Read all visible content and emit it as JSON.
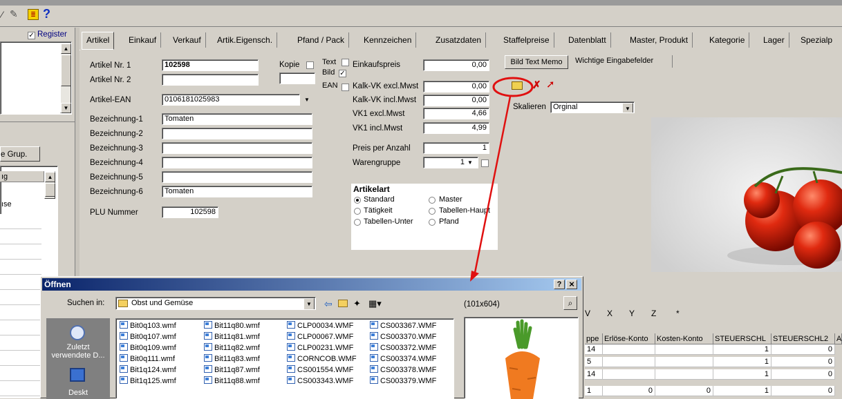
{
  "toolbar": {
    "help_label": "?"
  },
  "left_panel": {
    "register_label": "Register",
    "register_checked": true,
    "group_tab_label": "e Grup.",
    "col_header": "ıg",
    "list_item": "ıse",
    "list_item2": "e"
  },
  "tabs": [
    "Artikel",
    "Einkauf",
    "Verkauf",
    "Artik.Eigensch.",
    "Pfand / Pack",
    "Kennzeichen",
    "Zusatzdaten",
    "Staffelpreise",
    "Datenblatt",
    "Master, Produkt",
    "Kategorie",
    "Lager",
    "Spezialp"
  ],
  "form": {
    "artikel_nr1_label": "Artikel Nr. 1",
    "artikel_nr1_value": "102598",
    "artikel_nr2_label": "Artikel Nr. 2",
    "artikel_nr2_value": "",
    "kopie_label": "Kopie",
    "artikel_ean_label": "Artikel-EAN",
    "artikel_ean_value": "0106181025983",
    "bez1_label": "Bezeichnung-1",
    "bez1_value": "Tomaten",
    "bez2_label": "Bezeichnung-2",
    "bez3_label": "Bezeichnung-3",
    "bez4_label": "Bezeichnung-4",
    "bez5_label": "Bezeichnung-5",
    "bez6_label": "Bezeichnung-6",
    "bez6_value": "Tomaten",
    "plu_label": "PLU Nummer",
    "plu_value": "102598",
    "text_label": "Text",
    "bild_label": "Bild",
    "ean_label": "EAN",
    "einkaufspreis_label": "Einkaufspreis",
    "einkaufspreis_value": "0,00",
    "kalk_vk_excl_label": "Kalk-VK excl.Mwst",
    "kalk_vk_excl_value": "0,00",
    "kalk_vk_incl_label": "Kalk-VK incl.Mwst",
    "kalk_vk_incl_value": "0,00",
    "vk1_excl_label": "VK1 excl.Mwst",
    "vk1_excl_value": "4,66",
    "vk1_incl_label": "VK1 incl.Mwst",
    "vk1_incl_value": "4,99",
    "preis_per_anzahl_label": "Preis per Anzahl",
    "preis_per_anzahl_value": "1",
    "warengruppe_label": "Warengruppe",
    "warengruppe_value": "1",
    "artikelart_label": "Artikelart",
    "artikelart_options": [
      "Standard",
      "Master",
      "Tätigkeit",
      "Tabellen-Haupt",
      "Tabellen-Unter",
      "Pfand"
    ]
  },
  "right_panel": {
    "subtab_active": "Bild Text Memo",
    "subtab_other": "Wichtige Eingabefelder",
    "skalieren_label": "Skalieren",
    "skalieren_value": "Orginal"
  },
  "alphabet": [
    "V",
    "X",
    "Y",
    "Z",
    "*"
  ],
  "grid": {
    "headers": [
      "ppe",
      "Erlöse-Konto",
      "Kosten-Konto",
      "STEUERSCHL",
      "STEUERSCHL2",
      "A"
    ],
    "rows": [
      [
        "14",
        "",
        "",
        "1",
        "0"
      ],
      [
        "5",
        "",
        "",
        "1",
        "0"
      ],
      [
        "14",
        "",
        "",
        "1",
        "0"
      ],
      [
        "1",
        "0",
        "0",
        "1",
        "0"
      ]
    ]
  },
  "dialog": {
    "title": "Öffnen",
    "help_btn": "?",
    "close_btn": "×",
    "suchen_in_label": "Suchen in:",
    "folder": "Obst und Gemüse",
    "preview_size": "(101x604)",
    "places": [
      "Zuletzt verwendete D...",
      "Deskt"
    ],
    "files": [
      [
        "Bit0q103.wmf",
        "Bit0q107.wmf",
        "Bit0q109.wmf",
        "Bit0q111.wmf",
        "Bit1q124.wmf",
        "Bit1q125.wmf"
      ],
      [
        "Bit11q80.wmf",
        "Bit11q81.wmf",
        "Bit11q82.wmf",
        "Bit11q83.wmf",
        "Bit11q87.wmf",
        "Bit11q88.wmf"
      ],
      [
        "CLP00034.WMF",
        "CLP00067.WMF",
        "CLP00231.WMF",
        "CORNCOB.WMF",
        "CS001554.WMF",
        "CS003343.WMF"
      ],
      [
        "CS003367.WMF",
        "CS003370.WMF",
        "CS003372.WMF",
        "CS003374.WMF",
        "CS003378.WMF",
        "CS003379.WMF"
      ]
    ]
  },
  "colors": {
    "window_bg": "#d4d0c8",
    "title_blue": "#0a246a",
    "annotation_red": "#e01010"
  }
}
